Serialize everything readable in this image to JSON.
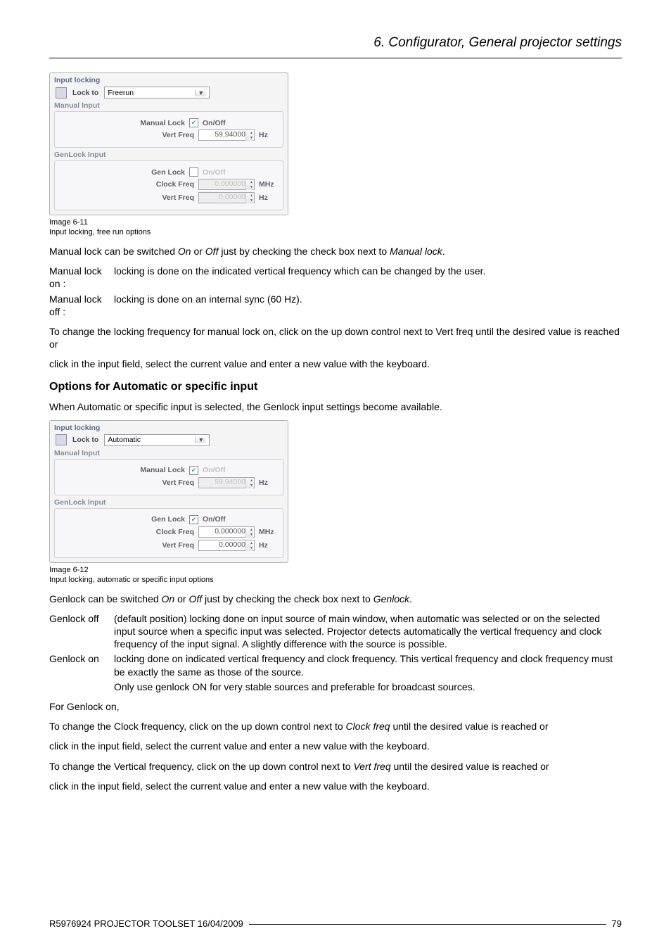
{
  "header": {
    "title": "6.  Configurator, General projector settings"
  },
  "panel_a": {
    "group_label": "Input locking",
    "lockto_label": "Lock to",
    "select_value": "Freerun",
    "manual_input_label": "Manual Input",
    "manual_lock_label": "Manual Lock",
    "manual_lock_onoff": "On/Off",
    "manual_lock_checked": true,
    "vert_freq_label": "Vert Freq",
    "vert_freq_value": "59,94000",
    "vert_freq_unit": "Hz",
    "genlock_input_label": "GenLock Input",
    "gen_lock_label": "Gen Lock",
    "gen_lock_onoff": "On/Off",
    "gen_lock_checked": false,
    "clock_freq_label": "Clock Freq",
    "clock_freq_value": "0,000000",
    "clock_freq_unit": "MHz",
    "gl_vert_freq_label": "Vert Freq",
    "gl_vert_freq_value": "0,00000",
    "gl_vert_freq_unit": "Hz"
  },
  "caption_a_num": "Image 6-11",
  "caption_a_text": "Input locking, free run options",
  "para1_a": "Manual lock can be switched ",
  "para1_on": "On",
  "para1_b": " or ",
  "para1_off": "Off",
  "para1_c": " just by checking the check box next to ",
  "para1_ml": "Manual lock",
  "para1_d": ".",
  "def1_term": "Manual lock on :",
  "def1_desc": "locking is done on the indicated vertical frequency which can be changed by the user.",
  "def2_term": "Manual lock off :",
  "def2_desc": "locking is done on an internal sync (60 Hz).",
  "para2": "To change the locking frequency for manual lock on, click on the up down control next to Vert freq until the desired value is reached or",
  "para3": "click in the input field, select the current value and enter a new value with the keyboard.",
  "section_heading": "Options for Automatic or specific input",
  "para4": "When Automatic or specific input is selected, the Genlock input settings become available.",
  "panel_b": {
    "group_label": "Input locking",
    "lockto_label": "Lock to",
    "select_value": "Automatic",
    "manual_input_label": "Manual Input",
    "manual_lock_label": "Manual Lock",
    "manual_lock_onoff": "On/Off",
    "manual_lock_checked": true,
    "vert_freq_label": "Vert Freq",
    "vert_freq_value": "59,94000",
    "vert_freq_unit": "Hz",
    "genlock_input_label": "GenLock Input",
    "gen_lock_label": "Gen Lock",
    "gen_lock_onoff": "On/Off",
    "gen_lock_checked": true,
    "clock_freq_label": "Clock Freq",
    "clock_freq_value": "0,000000",
    "clock_freq_unit": "MHz",
    "gl_vert_freq_label": "Vert Freq",
    "gl_vert_freq_value": "0,00000",
    "gl_vert_freq_unit": "Hz"
  },
  "caption_b_num": "Image 6-12",
  "caption_b_text": "Input locking, automatic or specific input options",
  "para5_a": "Genlock can be switched ",
  "para5_on": "On",
  "para5_b": " or ",
  "para5_off": "Off",
  "para5_c": " just by checking the check box next to ",
  "para5_gl": "Genlock",
  "para5_d": ".",
  "def3_term": "Genlock off",
  "def3_desc": "(default position) locking done on input source of main window, when automatic was selected or on the selected input source when a specific input was selected. Projector detects automatically the vertical frequency and clock frequency of the input signal. A slightly difference with the source is possible.",
  "def4_term": "Genlock on",
  "def4_desc": "locking done on indicated vertical frequency and clock frequency. This vertical frequency and clock frequency must be exactly the same as those of the source.",
  "def4_extra": "Only use genlock ON for very stable sources and preferable for broadcast sources.",
  "para6": "For Genlock on,",
  "para7_a": "To change the Clock frequency, click on the up down control next to ",
  "para7_cf": "Clock freq",
  "para7_b": " until the desired value is reached or",
  "para8": "click in the input field, select the current value and enter a new value with the keyboard.",
  "para9_a": "To change the Vertical frequency, click on the up down control next to ",
  "para9_vf": "Vert freq",
  "para9_b": " until the desired value is reached or",
  "para10": "click in the input field, select the current value and enter a new value with the keyboard.",
  "footer_left": "R5976924   PROJECTOR TOOLSET  16/04/2009",
  "footer_right": "79"
}
